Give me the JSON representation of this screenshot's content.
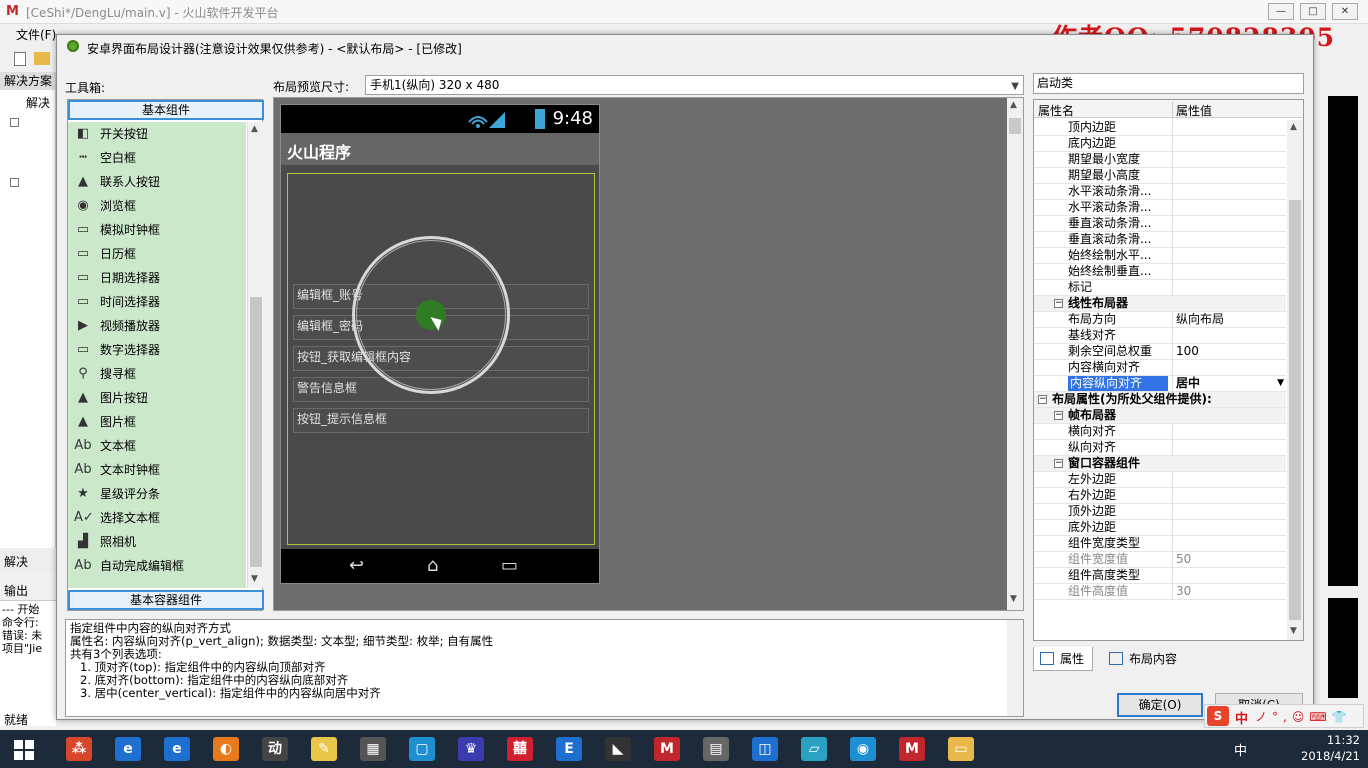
{
  "ide": {
    "title": "[CeShi*/DengLu/main.v] - 火山软件开发平台",
    "logo": "M",
    "menu_file": "文件(F)",
    "left_panel_title": "解决方案",
    "left_panel_item": "解决",
    "left_bottom_tab": "解决",
    "output_title": "输出",
    "output_lines": [
      "--- 开始",
      "命令行:",
      "错误: 未",
      "项目\"Jie"
    ],
    "status": "就绪",
    "win_min": "—",
    "win_max": "□",
    "win_close": "✕"
  },
  "watermark": "作者QQ: 570828305",
  "dialog": {
    "title": "安卓界面布局设计器(注意设计效果仅供参考) - <默认布局> - [已修改]",
    "toolbox_label": "工具箱:",
    "preview_size_label": "布局预览尺寸:",
    "preview_size_value": "手机1(纵向) 320 x 480",
    "startup_class": "启动类",
    "ok_label": "确定(O)",
    "cancel_label": "取消(C)"
  },
  "toolbox": {
    "group_basic": "基本组件",
    "group_container": "基本容器组件",
    "items": [
      {
        "label": "开关按钮",
        "icon": "switch-icon"
      },
      {
        "label": "空白框",
        "icon": "space-icon"
      },
      {
        "label": "联系人按钮",
        "icon": "contact-icon"
      },
      {
        "label": "浏览框",
        "icon": "browser-icon"
      },
      {
        "label": "模拟时钟框",
        "icon": "analog-clock-icon"
      },
      {
        "label": "日历框",
        "icon": "calendar-icon"
      },
      {
        "label": "日期选择器",
        "icon": "date-picker-icon"
      },
      {
        "label": "时间选择器",
        "icon": "time-picker-icon"
      },
      {
        "label": "视频播放器",
        "icon": "video-player-icon"
      },
      {
        "label": "数字选择器",
        "icon": "number-picker-icon"
      },
      {
        "label": "搜寻框",
        "icon": "search-icon"
      },
      {
        "label": "图片按钮",
        "icon": "image-button-icon"
      },
      {
        "label": "图片框",
        "icon": "image-icon"
      },
      {
        "label": "文本框",
        "icon": "text-icon"
      },
      {
        "label": "文本时钟框",
        "icon": "text-clock-icon"
      },
      {
        "label": "星级评分条",
        "icon": "star-icon"
      },
      {
        "label": "选择文本框",
        "icon": "checked-text-icon"
      },
      {
        "label": "照相机",
        "icon": "camera-icon"
      },
      {
        "label": "自动完成编辑框",
        "icon": "autocomplete-icon"
      }
    ]
  },
  "phone": {
    "time": "9:48",
    "app_title": "火山程序",
    "components": [
      "编辑框_账号",
      "编辑框_密码",
      "按钮_获取编辑框内容",
      "警告信息框",
      "按钮_提示信息框"
    ],
    "nav_back": "↩",
    "nav_home": "⌂",
    "nav_recent": "▭"
  },
  "description": {
    "lines": [
      "指定组件中内容的纵向对齐方式",
      "属性名: 内容纵向对齐(p_vert_align); 数据类型: 文本型; 细节类型: 枚举; 自有属性",
      "共有3个列表选项:",
      "  1. 顶对齐(top): 指定组件中的内容纵向顶部对齐",
      "  2. 底对齐(bottom): 指定组件中的内容纵向底部对齐",
      "  3. 居中(center_vertical): 指定组件中的内容纵向居中对齐"
    ]
  },
  "properties": {
    "col_name": "属性名",
    "col_value": "属性值",
    "rows": [
      {
        "name": "顶内边距",
        "value": ""
      },
      {
        "name": "底内边距",
        "value": ""
      },
      {
        "name": "期望最小宽度",
        "value": ""
      },
      {
        "name": "期望最小高度",
        "value": ""
      },
      {
        "name": "水平滚动条滑...",
        "value": ""
      },
      {
        "name": "水平滚动条滑...",
        "value": ""
      },
      {
        "name": "垂直滚动条滑...",
        "value": ""
      },
      {
        "name": "垂直滚动条滑...",
        "value": ""
      },
      {
        "name": "始终绘制水平...",
        "value": ""
      },
      {
        "name": "始终绘制垂直...",
        "value": ""
      },
      {
        "name": "标记",
        "value": ""
      },
      {
        "name": "线性布局器",
        "value": "",
        "cat": true
      },
      {
        "name": "布局方向",
        "value": "纵向布局"
      },
      {
        "name": "基线对齐",
        "value": ""
      },
      {
        "name": "剩余空间总权重",
        "value": "100"
      },
      {
        "name": "内容横向对齐",
        "value": ""
      },
      {
        "name": "内容纵向对齐",
        "value": "居中",
        "selected": true
      },
      {
        "name": "布局属性(为所处父组件提供):",
        "value": "",
        "cat": true,
        "top": true
      },
      {
        "name": "帧布局器",
        "value": "",
        "cat": true
      },
      {
        "name": "横向对齐",
        "value": ""
      },
      {
        "name": "纵向对齐",
        "value": ""
      },
      {
        "name": "窗口容器组件",
        "value": "",
        "cat": true
      },
      {
        "name": "左外边距",
        "value": ""
      },
      {
        "name": "右外边距",
        "value": ""
      },
      {
        "name": "顶外边距",
        "value": ""
      },
      {
        "name": "底外边距",
        "value": ""
      },
      {
        "name": "组件宽度类型",
        "value": ""
      },
      {
        "name": "组件宽度值",
        "value": "50",
        "dim": true
      },
      {
        "name": "组件高度类型",
        "value": ""
      },
      {
        "name": "组件高度值",
        "value": "30",
        "dim": true
      }
    ],
    "tab_props": "属性",
    "tab_layout": "布局内容"
  },
  "taskbar": {
    "time": "11:32",
    "date": "2018/4/21",
    "ime": "中",
    "sogou_s": "S",
    "sogou_zh": "中",
    "sogou_rest": "ノ°,☺⌨👕",
    "apps": [
      "⁂",
      "e",
      "e",
      "◐",
      "动",
      "✎",
      "▦",
      "▢",
      "♛",
      "囍",
      "E",
      "◣",
      "M",
      "▤",
      "◫",
      "▱",
      "◉",
      "M",
      "▭"
    ]
  },
  "colors": {
    "toolbox_bg": "#cbe8cb",
    "accent_blue": "#3273e6",
    "watermark_red": "#d4171b",
    "phone_bg": "#4a4a4a"
  }
}
